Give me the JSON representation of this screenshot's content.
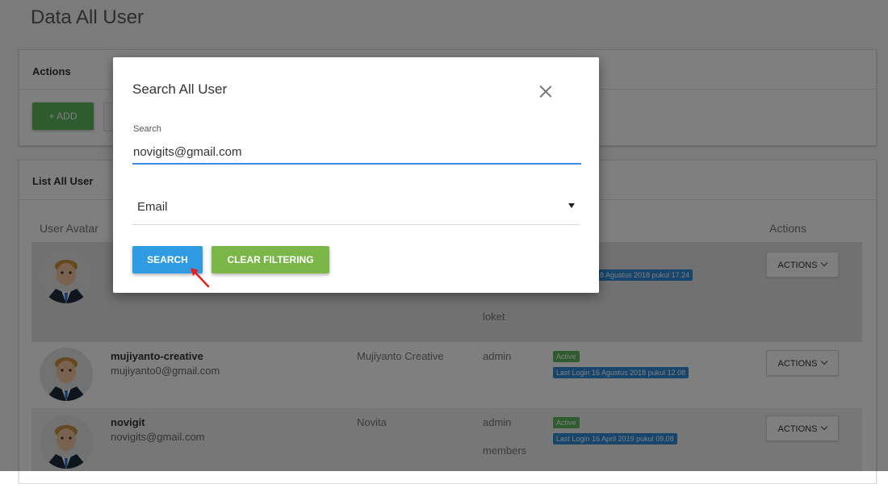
{
  "page": {
    "title": "Data All User"
  },
  "actions_card": {
    "title": "Actions",
    "add_label": "+ ADD"
  },
  "list_card": {
    "title": "List All User",
    "columns": {
      "avatar": "User Avatar",
      "actions": "Actions"
    }
  },
  "users": [
    {
      "username": "",
      "email": "",
      "fullname": "",
      "roles": [
        "loket"
      ],
      "status": "",
      "last_login": "8 Agustus 2018 pukul 17.24",
      "actions_label": "ACTIONS"
    },
    {
      "username": "mujiyanto-creative",
      "email": "mujiyanto0@gmail.com",
      "fullname": "Mujiyanto Creative",
      "roles": [
        "admin"
      ],
      "status": "Active",
      "last_login": "Last Login 16 Agustus 2018 pukul 12.08",
      "actions_label": "ACTIONS"
    },
    {
      "username": "novigit",
      "email": "novigits@gmail.com",
      "fullname": "Novita",
      "roles": [
        "admin",
        "members"
      ],
      "status": "Active",
      "last_login": "Last Login 16 April 2019 pukul 09.08",
      "actions_label": "ACTIONS"
    }
  ],
  "modal": {
    "title": "Search All User",
    "search_label": "Search",
    "search_value": "novigits@gmail.com",
    "filter_selected": "Email",
    "search_button": "SEARCH",
    "clear_button": "CLEAR FILTERING"
  },
  "colors": {
    "primary": "#2f9be3",
    "success": "#5cb85c",
    "clear": "#7ab648",
    "badge_blue": "#2e8ad8",
    "annotation_arrow": "#e8201c"
  },
  "icons": {
    "close": "close-icon",
    "dropdown": "chevron-down-icon",
    "select_arrow": "caret-down-icon",
    "avatar": "user-avatar-icon",
    "annotation": "arrow-annotation-icon"
  }
}
